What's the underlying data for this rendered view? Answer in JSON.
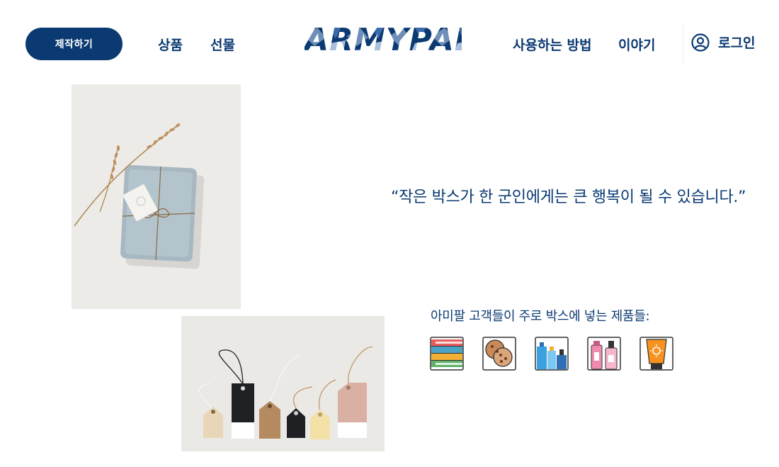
{
  "header": {
    "make_button": "제작하기",
    "nav_left": [
      {
        "id": "products",
        "label": "상품"
      },
      {
        "id": "gift",
        "label": "선물"
      }
    ],
    "logo_text": "ARMYPAL",
    "nav_right": [
      {
        "id": "how-to-use",
        "label": "사용하는 방법"
      },
      {
        "id": "story",
        "label": "이야기"
      }
    ],
    "login_label": "로그인"
  },
  "main": {
    "quote": "“작은 박스가 한 군인에게는 큰 행복이 될 수 있습니다.”",
    "products_title": "아미팔 고객들이 주로 박스에 넣는 제품들:",
    "product_icons": [
      "books-icon",
      "cookies-icon",
      "bottles-icon",
      "cosmetics-icon",
      "sunscreen-icon"
    ]
  },
  "colors": {
    "primary": "#0b3a72",
    "background": "#ffffff"
  }
}
